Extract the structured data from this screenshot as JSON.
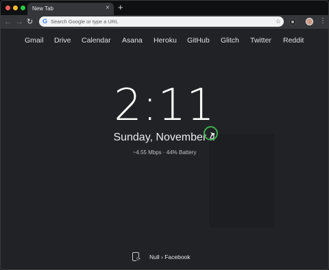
{
  "browser": {
    "tab": {
      "title": "New Tab",
      "close": "×"
    },
    "new_tab": "+",
    "omnibox": {
      "placeholder": "Search Google or type a URL",
      "icon": "G"
    },
    "nav": {
      "back": "←",
      "forward": "→",
      "reload": "↻"
    },
    "bookmark_icon": "☆",
    "menu_icon": "⋮"
  },
  "page": {
    "links": [
      "Gmail",
      "Drive",
      "Calendar",
      "Asana",
      "Heroku",
      "GitHub",
      "Glitch",
      "Twitter",
      "Reddit"
    ],
    "clock": "2:11",
    "date": "Sunday, November 4",
    "status": "~4.55 Mbps · 44% Battery",
    "footer": "Null › Facebook"
  },
  "colors": {
    "background": "#202225",
    "cursor_ring": "#3fae4f"
  }
}
